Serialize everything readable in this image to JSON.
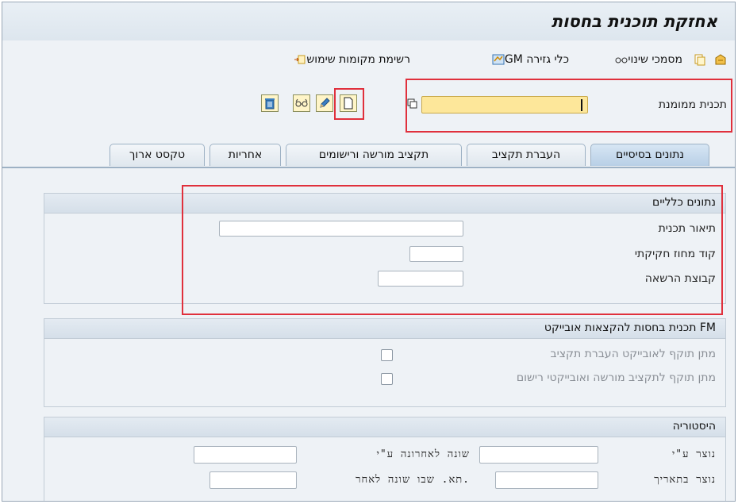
{
  "title": "אחזקת תוכנית בחסות",
  "toolbar": {
    "items": [
      {
        "label": ""
      },
      {
        "label": ""
      },
      {
        "label": "מסמכי שינוי"
      },
      {
        "label": "GM כלי גזירה"
      },
      {
        "label": "רשימת מקומות שימוש"
      }
    ]
  },
  "sponsored_program": {
    "label": "תכנית ממומנת",
    "value": ""
  },
  "tabs": [
    {
      "label": "נתונים בסיסיים",
      "active": true
    },
    {
      "label": "העברת תקציב",
      "active": false
    },
    {
      "label": "תקציב מורשה ורישומים",
      "active": false
    },
    {
      "label": "אחריות",
      "active": false
    },
    {
      "label": "טקסט ארוך",
      "active": false
    }
  ],
  "general_data": {
    "header": "נתונים כלליים",
    "fields": [
      {
        "label": "תיאור תכנית",
        "value": ""
      },
      {
        "label": "קוד מחוז חקיקתי",
        "value": ""
      },
      {
        "label": "קבוצת הרשאה",
        "value": ""
      }
    ]
  },
  "fm_group": {
    "header": "תכנית בחסות להקצאות אובייקט FM",
    "checkboxes": [
      {
        "label": "מתן תוקף לאובייקט העברת תקציב",
        "checked": false
      },
      {
        "label": "מתן תוקף לתקציב מורשה ואובייקטי רישום",
        "checked": false
      }
    ]
  },
  "history": {
    "header": "היסטוריה",
    "fields": [
      {
        "label": "נוצר ע\"י",
        "value": ""
      },
      {
        "label": "שונה לאחרונה ע\"י",
        "value": ""
      },
      {
        "label": "נוצר בתאריך",
        "value": ""
      },
      {
        "label": "תא. שבו שונה לאחר.",
        "value": ""
      }
    ]
  },
  "colors": {
    "highlight": "#e0303c",
    "required_field": "#fde79a",
    "active_tab": "#c5daef"
  }
}
